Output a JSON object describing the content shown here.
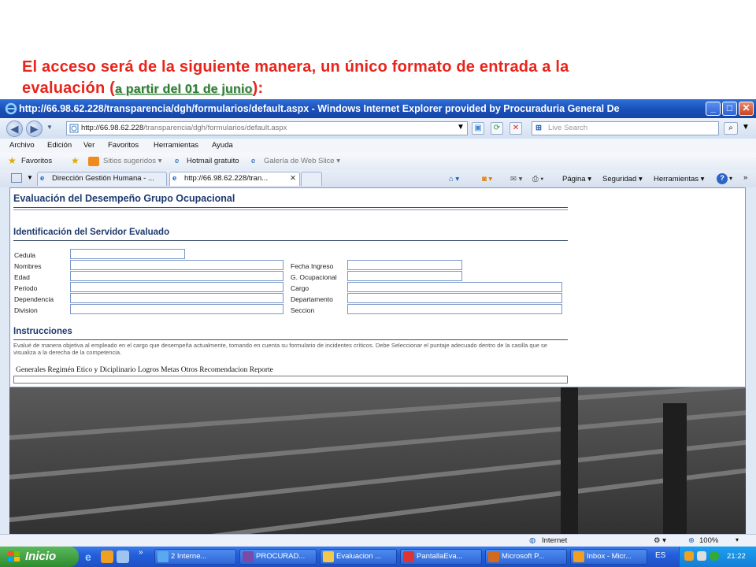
{
  "caption": {
    "line1": "El acceso será de la siguiente manera, un único formato de entrada a la",
    "line2_before": "evaluación (",
    "link": "a partir del 01 de junio",
    "line2_after": "):"
  },
  "window": {
    "title": "http://66.98.62.228/transparencia/dgh/formularios/default.aspx - Windows Internet Explorer provided by Procuraduria General De",
    "minimize": "_",
    "maximize": "□",
    "close": "✕"
  },
  "address": {
    "url_host": "http://66.98.62.228",
    "url_path": "/transparencia/dgh/formularios/default.aspx",
    "search_placeholder": "Live Search"
  },
  "menu": [
    "Archivo",
    "Edición",
    "Ver",
    "Favoritos",
    "Herramientas",
    "Ayuda"
  ],
  "favorites_bar": {
    "favorites": "Favoritos",
    "suggested": "Sitios sugeridos ▾",
    "hotmail": "Hotmail gratuito",
    "gallery": "Galería de Web Slice ▾"
  },
  "tabs": [
    {
      "label": "Dirección Gestión Humana - ..."
    },
    {
      "label": "http://66.98.62.228/tran..."
    }
  ],
  "commands": {
    "page": "Página ▾",
    "security": "Seguridad ▾",
    "tools": "Herramientas ▾"
  },
  "form": {
    "title": "Evaluación del Desempeño Grupo Ocupacional",
    "section_ident": "Identificación del Servidor Evaluado",
    "labels": {
      "cedula": "Cedula",
      "nombres": "Nombres",
      "edad": "Edad",
      "periodo": "Periodo",
      "dependencia": "Dependencia",
      "division": "Division",
      "fecha_ingreso": "Fecha Ingreso",
      "g_ocupacional": "G. Ocupacional",
      "cargo": "Cargo",
      "departamento": "Departamento",
      "seccion": "Seccion"
    },
    "section_instr": "Instrucciones",
    "instructions": "Evalué de manera objetiva al empleado en el cargo que desempeña actualmente, tomando en cuenta su formulario de incidentes críticos. Debe Seleccionar el puntaje adecuado dentro de la casilla que se visualiza a la derecha de la competencia.",
    "section_tabs": "Generales Regimén Etico y Diciplinario Logros Metas Otros Recomendacion Reporte"
  },
  "status": {
    "zone": "Internet",
    "zoom": "100%"
  },
  "taskbar": {
    "start": "Inicio",
    "items": [
      "2 Interne...",
      "PROCURAD...",
      "Evaluacion ...",
      "PantallaEva...",
      "Microsoft P...",
      "Inbox - Micr..."
    ],
    "lang": "ES",
    "time": "21:22"
  },
  "colors": {
    "caption_red": "#e8241c",
    "link_green": "#2e7d32",
    "heading_blue": "#1d3a6e",
    "taskbar_blue": "#245edb"
  }
}
